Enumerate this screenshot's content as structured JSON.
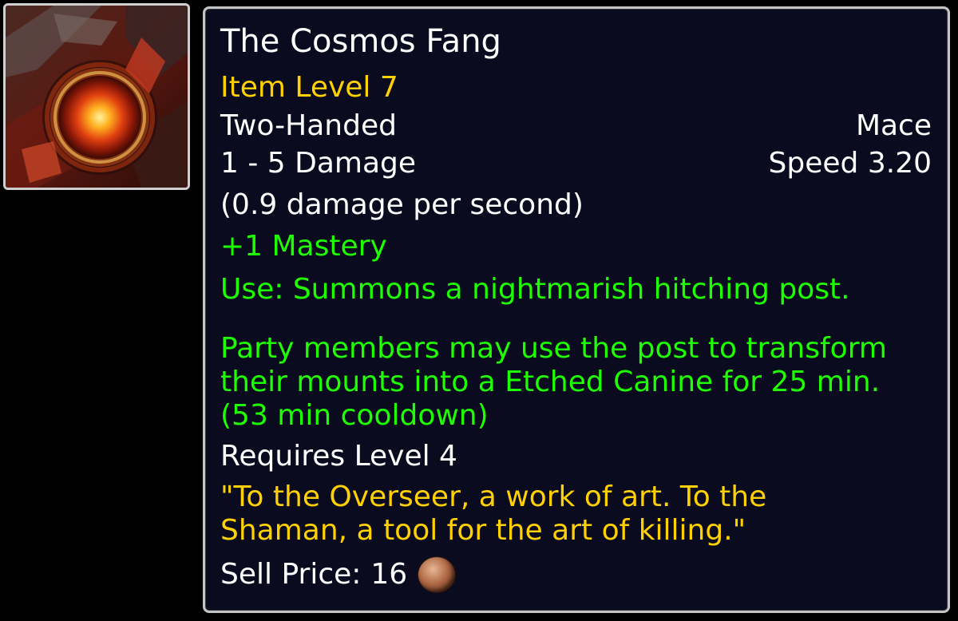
{
  "item": {
    "icon": "mace-item-icon",
    "name": "The Cosmos Fang",
    "item_level": "Item Level 7",
    "binding": "Two-Handed",
    "type": "Mace",
    "damage": "1 - 5 Damage",
    "speed": "Speed 3.20",
    "dps": "(0.9 damage per second)",
    "stat": "+1 Mastery",
    "use": "Use: Summons a nightmarish hitching post.",
    "use_detail_line1": "Party members may use the post to transform",
    "use_detail_line2": "their mounts into a Etched Canine for 25 min.",
    "use_detail_line3": "(53 min cooldown)",
    "requires": "Requires Level 4",
    "flavor_line1": "\"To the Overseer, a work of art. To the",
    "flavor_line2": "Shaman, a tool for the art of killing.\"",
    "sell_label": "Sell Price:",
    "sell_value": "16",
    "coin_icon": "copper-coin-icon"
  },
  "colors": {
    "yellow": "#ffd100",
    "green": "#1eff00",
    "white": "#ffffff",
    "background": "#0a0b1f"
  }
}
